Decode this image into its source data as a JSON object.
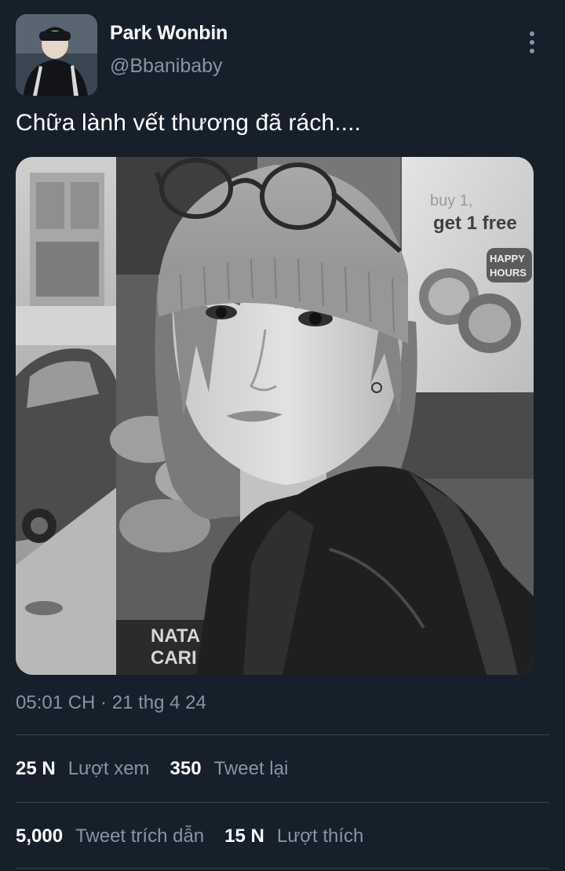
{
  "user": {
    "display_name": "Park Wonbin",
    "handle": "@Bbanibaby"
  },
  "tweet": {
    "text": "Chữa lành vết thương đã rách....",
    "timestamp": "05:01 CH · 21 thg 4 24"
  },
  "photo": {
    "signage_offer": "get 1 free",
    "signage_buy": "buy 1,",
    "signage_happy": "HAPPY",
    "signage_hours": "HOURS",
    "signage_nata": "NATA",
    "signage_cari": "CARI"
  },
  "stats": {
    "views_count": "25 N",
    "views_label": "Lượt xem",
    "retweets_count": "350",
    "retweets_label": "Tweet lại",
    "quotes_count": "5,000",
    "quotes_label": "Tweet trích dẫn",
    "likes_count": "15 N",
    "likes_label": "Lượt thích"
  },
  "icons": {
    "more": "more-vertical-icon"
  },
  "colors": {
    "background": "#16202b",
    "secondary_text": "#8595a6",
    "divider": "#38444d"
  }
}
